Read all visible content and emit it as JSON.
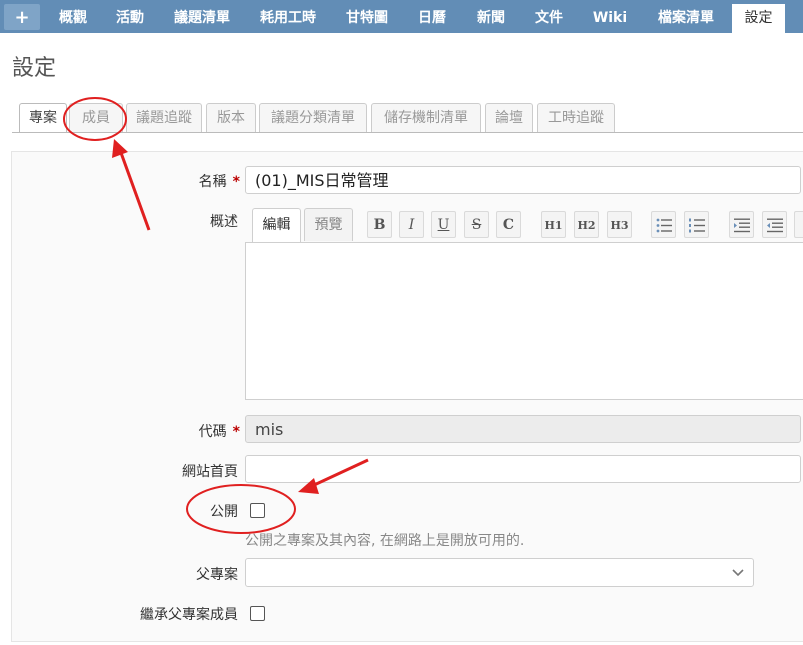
{
  "top_menu": {
    "plus": "+",
    "items": [
      "概觀",
      "活動",
      "議題清單",
      "耗用工時",
      "甘特圖",
      "日曆",
      "新聞",
      "文件",
      "Wiki",
      "檔案清單",
      "設定"
    ]
  },
  "page_title": "設定",
  "tabs": [
    "專案",
    "成員",
    "議題追蹤",
    "版本",
    "議題分類清單",
    "儲存機制清單",
    "論壇",
    "工時追蹤"
  ],
  "form": {
    "name_label": "名稱",
    "required_mark": "*",
    "name_value": "(01)_MIS日常管理",
    "description_label": "概述",
    "editor_tabs": [
      "編輯",
      "預覽"
    ],
    "toolbar_labels": {
      "h1": "H1",
      "h2": "H2",
      "h3": "H3"
    },
    "toolbar_icons": [
      "bold-icon",
      "italic-icon",
      "underline-icon",
      "strikethrough-icon",
      "code-icon",
      "h1-icon",
      "h2-icon",
      "h3-icon",
      "unordered-list-icon",
      "ordered-list-icon",
      "indent-icon",
      "outdent-icon"
    ],
    "identifier_label": "代碼",
    "identifier_value": "mis",
    "homepage_label": "網站首頁",
    "homepage_value": "",
    "public_label": "公開",
    "public_hint": "公開之專案及其內容, 在網路上是開放可用的.",
    "parent_label": "父專案",
    "parent_value": "",
    "inherit_label": "繼承父專案成員"
  },
  "colors": {
    "menu_bg": "#628db6",
    "required": "#bb0000",
    "annotation": "#e02020"
  }
}
